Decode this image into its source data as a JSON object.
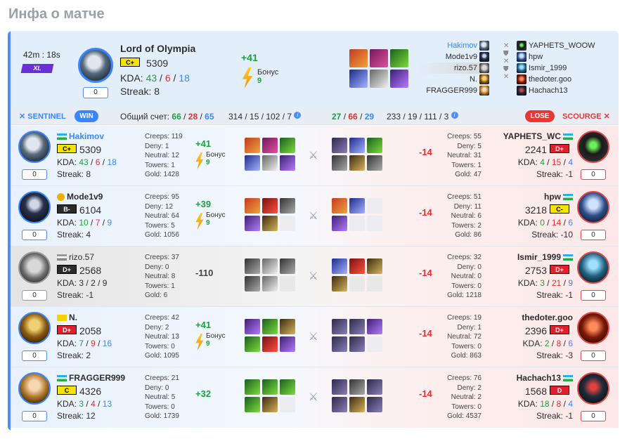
{
  "page_title": "Инфа о матче",
  "summary": {
    "duration": "42m : 18s",
    "tier": "XL",
    "mmr_change": "0",
    "name": "Lord of Olympia",
    "rank": "C+",
    "rating": "5309",
    "kda_label": "KDA:",
    "kills": "43",
    "deaths": "6",
    "assists": "18",
    "streak": "Streak: 8",
    "delta": "+41",
    "bonus_label": "Бонус",
    "bonus_value": "9"
  },
  "sentinel_players": [
    "Hakimov",
    "Mode1v9",
    "rizo.57",
    "N.",
    "FRAGGER999"
  ],
  "scourge_players": [
    "YAPHETS_WOOW",
    "hpw",
    "Ismir_1999",
    "thedoter.goo",
    "Hachach13"
  ],
  "team_bar": {
    "sentinel_label": "SENTINEL",
    "win_label": "WIN",
    "score_label": "Общий счет:",
    "left_score": [
      "66",
      "28",
      "65"
    ],
    "left_farm": "314 / 15 / 102 / 7",
    "right_score": [
      "27",
      "66",
      "29"
    ],
    "right_farm": "233 / 19 / 111 / 3",
    "lose_label": "LOSE",
    "scourge_label": "SCOURGE",
    "info": "i"
  },
  "rows": [
    {
      "left": {
        "name": "Hakimov",
        "rank": "C+",
        "rating": "5309",
        "kda": [
          "43",
          "6",
          "18"
        ],
        "streak": "Streak: 8",
        "mmr": "0",
        "creeps": "Creeps: 119",
        "deny": "Deny: 1",
        "neutral": "Neutral: 12",
        "towers": "Towers: 1",
        "gold": "Gold: 1428",
        "delta": "+41",
        "bonus_label": "Бонус",
        "bonus_value": "9"
      },
      "right": {
        "name": "YAPHETS_WC",
        "rank": "D+",
        "rating": "2241",
        "kda": [
          "4",
          "15",
          "4"
        ],
        "streak": "Streak: -1",
        "mmr": "0",
        "creeps": "Creeps: 55",
        "deny": "Deny: 5",
        "neutral": "Neutral: 31",
        "towers": "Towers: 1",
        "gold": "Gold: 47",
        "delta": "-14"
      }
    },
    {
      "left": {
        "name": "Mode1v9",
        "rank": "B-",
        "rating": "6104",
        "kda": [
          "10",
          "7",
          "9"
        ],
        "streak": "Streak: 4",
        "mmr": "0",
        "creeps": "Creeps: 95",
        "deny": "Deny: 12",
        "neutral": "Neutral: 64",
        "towers": "Towers: 5",
        "gold": "Gold: 1056",
        "delta": "+39",
        "bonus_label": "Бонус",
        "bonus_value": "9"
      },
      "right": {
        "name": "hpw",
        "rank": "C-",
        "rating": "3218",
        "kda": [
          "0",
          "14",
          "6"
        ],
        "streak": "Streak: -10",
        "mmr": "0",
        "creeps": "Creeps: 51",
        "deny": "Deny: 11",
        "neutral": "Neutral: 6",
        "towers": "Towers: 2",
        "gold": "Gold: 86",
        "delta": "-14"
      }
    },
    {
      "left": {
        "name": "rizo.57",
        "rank": "D+",
        "rating": "2568",
        "kda": [
          "3",
          "2",
          "9"
        ],
        "streak": "Streak: -1",
        "mmr": "0",
        "creeps": "Creeps: 37",
        "deny": "Deny: 0",
        "neutral": "Neutral: 8",
        "towers": "Towers: 1",
        "gold": "Gold: 6",
        "delta": "-110"
      },
      "right": {
        "name": "Ismir_1999",
        "rank": "D+",
        "rating": "2753",
        "kda": [
          "3",
          "21",
          "9"
        ],
        "streak": "Streak: -1",
        "mmr": "0",
        "creeps": "Creeps: 32",
        "deny": "Deny: 0",
        "neutral": "Neutral: 0",
        "towers": "Towers: 0",
        "gold": "Gold: 1218",
        "delta": "-14"
      }
    },
    {
      "left": {
        "name": "N.",
        "rank": "D+",
        "rating": "2058",
        "kda": [
          "7",
          "9",
          "16"
        ],
        "streak": "Streak: 2",
        "mmr": "0",
        "creeps": "Creeps: 42",
        "deny": "Deny: 2",
        "neutral": "Neutral: 13",
        "towers": "Towers: 0",
        "gold": "Gold: 1095",
        "delta": "+41",
        "bonus_label": "Бонус",
        "bonus_value": "9"
      },
      "right": {
        "name": "thedoter.goo",
        "rank": "D+",
        "rating": "2396",
        "kda": [
          "2",
          "8",
          "6"
        ],
        "streak": "Streak: -3",
        "mmr": "0",
        "creeps": "Creeps: 19",
        "deny": "Deny: 1",
        "neutral": "Neutral: 72",
        "towers": "Towers: 0",
        "gold": "Gold: 863",
        "delta": "-14"
      }
    },
    {
      "left": {
        "name": "FRAGGER999",
        "rank": "C",
        "rating": "4326",
        "kda": [
          "3",
          "4",
          "13"
        ],
        "streak": "Streak: 12",
        "mmr": "0",
        "creeps": "Creeps: 21",
        "deny": "Deny: 0",
        "neutral": "Neutral: 5",
        "towers": "Towers: 0",
        "gold": "Gold: 1739",
        "delta": "+32"
      },
      "right": {
        "name": "Hachach13",
        "rank": "D",
        "rating": "1568",
        "kda": [
          "18",
          "8",
          "4"
        ],
        "streak": "Streak: -1",
        "mmr": "0",
        "creeps": "Creeps: 76",
        "deny": "Deny: 2",
        "neutral": "Neutral: 2",
        "towers": "Towers: 0",
        "gold": "Gold: 4537",
        "delta": "-14"
      }
    }
  ],
  "labels": {
    "kda": "KDA:",
    "slash": "/"
  },
  "icons": {
    "vs": "crossed-swords-icon",
    "bonus": "lightning-bolt-icon",
    "flag": "uz-flag-icon",
    "info": "info-icon"
  }
}
